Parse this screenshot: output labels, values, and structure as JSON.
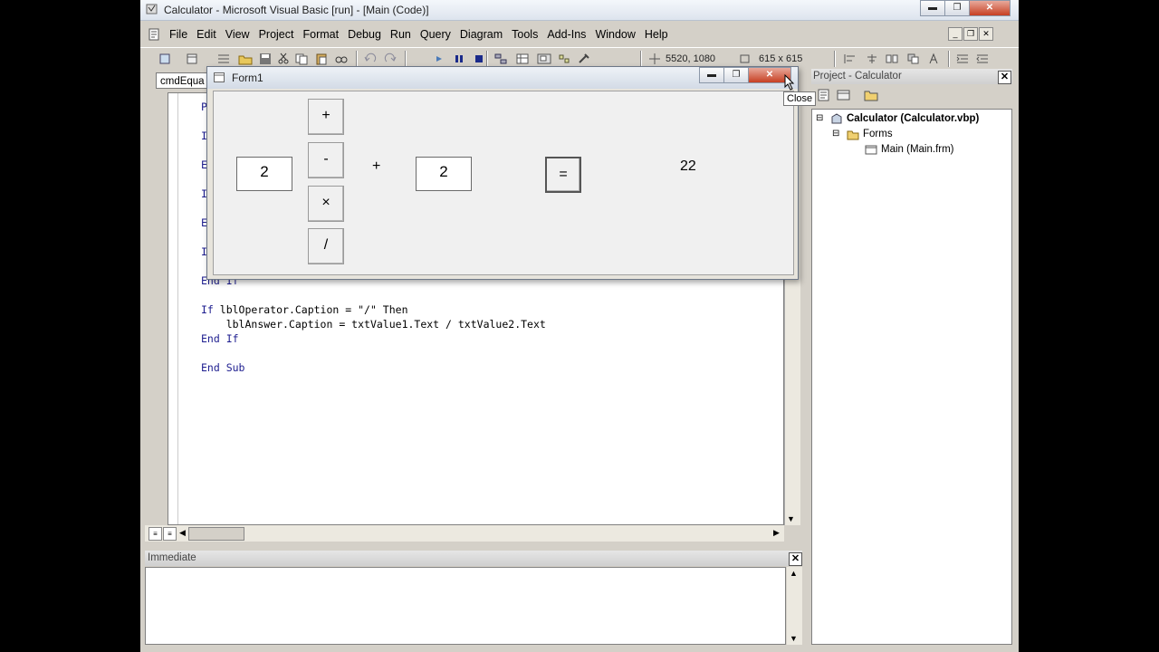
{
  "window": {
    "title": "Calculator - Microsoft Visual Basic [run] - [Main (Code)]"
  },
  "menu": [
    "File",
    "Edit",
    "View",
    "Project",
    "Format",
    "Debug",
    "Run",
    "Query",
    "Diagram",
    "Tools",
    "Add-Ins",
    "Window",
    "Help"
  ],
  "toolbar": {
    "position": "5520, 1080",
    "size": "615 x 615"
  },
  "code_window": {
    "object_combo": "cmdEqua",
    "lines": [
      {
        "indent": "",
        "kw": "Priv",
        "rest": ""
      },
      {
        "indent": "",
        "kw": "If",
        "rest": " l"
      },
      {
        "indent": "",
        "kw": "End",
        "rest": ""
      },
      {
        "indent": "",
        "kw": "If",
        "rest": " l"
      },
      {
        "indent": "",
        "kw": "End",
        "rest": ""
      },
      {
        "indent": "",
        "kw": "If",
        "rest": " l"
      },
      {
        "indent": "",
        "kw": "End If",
        "rest": ""
      },
      {
        "indent": "",
        "kw": "If",
        "rest": " lblOperator.Caption = \"/\" Then"
      },
      {
        "indent": "    ",
        "kw": "",
        "rest": "lblAnswer.Caption = txtValue1.Text / txtValue2.Text"
      },
      {
        "indent": "",
        "kw": "End If",
        "rest": ""
      },
      {
        "indent": "",
        "kw": "End Sub",
        "rest": ""
      }
    ]
  },
  "immediate": {
    "title": "Immediate"
  },
  "project": {
    "title": "Project - Calculator",
    "root": "Calculator (Calculator.vbp)",
    "folder": "Forms",
    "form": "Main (Main.frm)"
  },
  "form1": {
    "title": "Form1",
    "value1": "2",
    "value2": "2",
    "operator": "+",
    "buttons": {
      "add": "+",
      "subtract": "-",
      "multiply": "×",
      "divide": "/",
      "equals": "="
    },
    "answer": "22"
  },
  "tooltip": "Close",
  "colors": {
    "keyword": "#1d1d8f",
    "close_button": "#c73f22"
  }
}
